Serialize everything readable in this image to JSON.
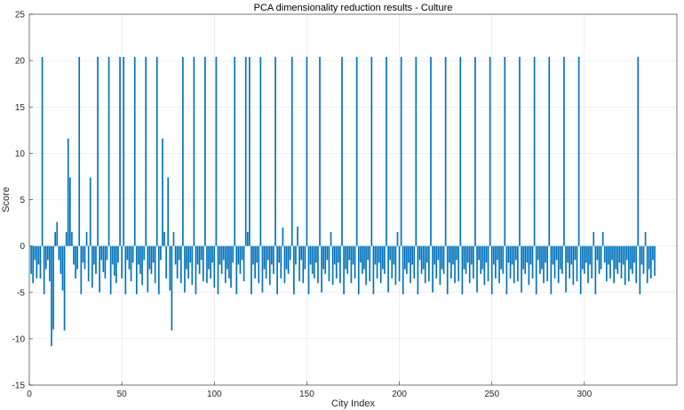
{
  "chart_data": {
    "type": "bar",
    "title": "PCA dimensionality reduction results - Culture",
    "xlabel": "City Index",
    "ylabel": "Score",
    "xlim": [
      0,
      350
    ],
    "ylim": [
      -15,
      25
    ],
    "xticks": [
      0,
      50,
      100,
      150,
      200,
      250,
      300
    ],
    "yticks": [
      -15,
      -10,
      -5,
      0,
      5,
      10,
      15,
      20,
      25
    ],
    "xtick_labels": [
      "0",
      "50",
      "100",
      "150",
      "200",
      "250",
      "300"
    ],
    "ytick_labels": [
      "-15",
      "-10",
      "-5",
      "0",
      "5",
      "10",
      "15",
      "20",
      "25"
    ],
    "grid": true,
    "bar_color": "#0072BD",
    "series": [
      {
        "values": [
          -3.0,
          -4.0,
          -1.5,
          -3.5,
          -2.0,
          -3.5,
          20.4,
          -5.2,
          -2.5,
          -1.5,
          -3.8,
          -10.8,
          -9.0,
          1.5,
          2.6,
          -1.5,
          -3.0,
          -4.8,
          -9.1,
          1.5,
          11.6,
          7.4,
          1.5,
          -2.0,
          -3.5,
          -2.5,
          20.4,
          -5.2,
          -1.8,
          -2.5,
          1.5,
          -3.8,
          7.4,
          -4.5,
          -2.0,
          -3.0,
          20.4,
          -5.0,
          -1.5,
          -2.8,
          -3.5,
          -1.5,
          20.4,
          -5.2,
          -2.0,
          -3.2,
          -4.0,
          -1.8,
          20.4,
          -3.5,
          20.4,
          -5.2,
          -1.5,
          -2.5,
          -3.8,
          -1.8,
          20.4,
          -5.2,
          -2.0,
          -3.0,
          -4.2,
          -1.5,
          20.4,
          -5.0,
          -2.5,
          -3.0,
          -1.8,
          -4.0,
          20.4,
          -5.2,
          -1.5,
          11.6,
          1.5,
          -3.5,
          7.4,
          -4.8,
          -9.1,
          1.5,
          -2.0,
          -3.5,
          -1.5,
          -4.0,
          20.4,
          -5.0,
          -2.5,
          -3.5,
          -1.8,
          -4.2,
          20.4,
          -5.2,
          -2.0,
          -3.0,
          -1.5,
          -3.8,
          20.4,
          -4.0,
          -2.5,
          -3.5,
          -1.8,
          -4.5,
          20.4,
          -5.2,
          -2.0,
          -3.0,
          -1.5,
          -4.0,
          -2.5,
          -3.5,
          -4.5,
          -1.8,
          20.4,
          -5.2,
          -2.0,
          -3.0,
          -1.5,
          -3.8,
          20.4,
          1.5,
          20.4,
          -5.2,
          -2.0,
          -3.5,
          -1.8,
          -4.0,
          20.4,
          -5.0,
          -2.5,
          -3.5,
          -1.5,
          -4.2,
          -2.0,
          -3.0,
          20.4,
          -5.2,
          -1.8,
          -3.5,
          2.0,
          -4.0,
          -2.5,
          -3.0,
          -1.5,
          20.4,
          -5.2,
          -2.0,
          2.1,
          -3.8,
          -1.5,
          -4.0,
          -2.5,
          20.4,
          -5.2,
          -2.0,
          -3.0,
          -3.5,
          -1.8,
          -4.0,
          20.4,
          -5.0,
          -2.5,
          -3.0,
          -1.5,
          -3.8,
          1.5,
          -4.2,
          -2.0,
          -3.5,
          -1.8,
          -4.0,
          20.4,
          -5.2,
          -2.5,
          -3.0,
          -1.5,
          -4.0,
          -2.0,
          -3.5,
          20.4,
          -5.2,
          -1.8,
          -3.0,
          -2.5,
          -4.2,
          -1.5,
          -3.8,
          20.4,
          -5.2,
          -2.0,
          -3.5,
          -1.8,
          -4.0,
          -2.5,
          -3.0,
          20.4,
          -5.0,
          -1.5,
          -3.5,
          -2.0,
          -4.2,
          1.5,
          -3.8,
          20.4,
          -5.2,
          -2.5,
          -3.0,
          -1.8,
          -4.0,
          -2.0,
          -3.5,
          20.4,
          -5.2,
          -1.5,
          -3.0,
          -2.5,
          -4.0,
          -1.8,
          -3.8,
          20.4,
          -5.0,
          -2.0,
          -3.5,
          -1.5,
          -4.2,
          -2.5,
          -3.0,
          20.4,
          -5.2,
          -1.8,
          -3.5,
          -2.0,
          -4.0,
          -1.5,
          -3.8,
          20.4,
          -5.2,
          -2.5,
          -3.0,
          -1.8,
          -4.0,
          -2.0,
          -3.5,
          20.4,
          -5.0,
          -1.5,
          -3.0,
          -2.5,
          -4.2,
          -1.8,
          -3.8,
          20.4,
          -5.2,
          -2.0,
          -3.5,
          -1.5,
          -4.0,
          -2.5,
          -3.0,
          20.4,
          -5.2,
          -1.8,
          -3.5,
          -2.0,
          -4.0,
          -1.5,
          -3.8,
          20.4,
          -5.0,
          -2.5,
          -3.0,
          -1.8,
          -4.2,
          -2.0,
          -3.5,
          20.4,
          -5.2,
          -1.5,
          -3.0,
          -2.5,
          -4.0,
          -1.8,
          -3.8,
          20.4,
          -5.2,
          -2.0,
          -3.5,
          -1.5,
          -4.0,
          -2.5,
          -3.0,
          20.4,
          -5.0,
          -1.8,
          -3.5,
          -2.0,
          -4.2,
          -1.5,
          -3.8,
          20.4,
          -5.2,
          -2.5,
          -3.0,
          -1.8,
          -4.0,
          -2.0,
          -3.5,
          1.5,
          -5.2,
          -1.5,
          -3.0,
          -2.5,
          1.5,
          -1.8,
          -3.8,
          -2.0,
          -3.5,
          -1.5,
          -4.0,
          -2.5,
          -3.0,
          -1.8,
          -3.5,
          -2.0,
          -4.2,
          -1.5,
          -3.8,
          -2.5,
          -3.0,
          -1.8,
          -4.0,
          20.4,
          -5.2,
          -2.0,
          -3.0,
          1.5,
          -4.0,
          -2.5,
          -3.5,
          -1.5,
          -3.2
        ]
      }
    ]
  }
}
